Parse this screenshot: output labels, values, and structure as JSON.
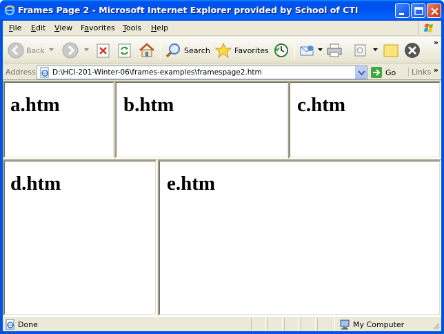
{
  "window": {
    "title": "Frames Page 2 - Microsoft Internet Explorer provided by School of CTI"
  },
  "menu": {
    "items": [
      {
        "accel": "F",
        "rest": "ile"
      },
      {
        "accel": "E",
        "rest": "dit"
      },
      {
        "accel": "V",
        "rest": "iew"
      },
      {
        "accel": "",
        "pre": "F",
        "accel2": "a",
        "rest": "vorites"
      },
      {
        "accel": "T",
        "rest": "ools"
      },
      {
        "accel": "H",
        "rest": "elp"
      }
    ]
  },
  "toolbar": {
    "back_label": "Back",
    "search_label": "Search",
    "favorites_label": "Favorites",
    "overflow": "»"
  },
  "address": {
    "label": "Address",
    "value": "D:\\HCI-201-Winter-06\\frames-examples\\framespage2.htm",
    "go_label": "Go",
    "links_label": "Links",
    "overflow": "»"
  },
  "frames": {
    "a": "a.htm",
    "b": "b.htm",
    "c": "c.htm",
    "d": "d.htm",
    "e": "e.htm"
  },
  "status": {
    "text": "Done",
    "zone": "My Computer"
  },
  "colors": {
    "titlebar": "#0054e3",
    "chrome": "#ece9d8",
    "frame_bg": "#ffffff"
  }
}
